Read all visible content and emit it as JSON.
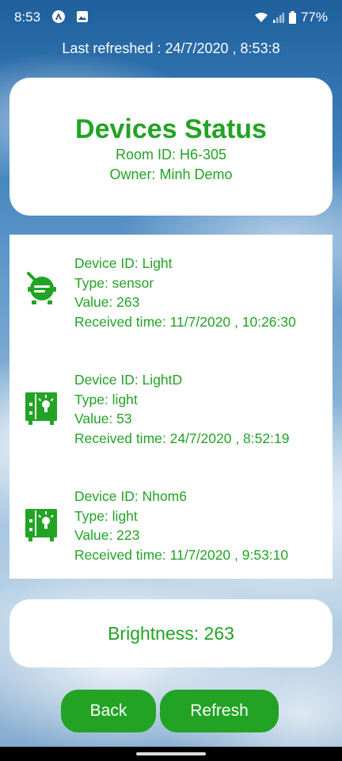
{
  "status_bar": {
    "time": "8:53",
    "battery": "77%"
  },
  "last_refreshed": "Last refreshed : 24/7/2020 , 8:53:8",
  "header": {
    "title": "Devices Status",
    "room": "Room ID: H6-305",
    "owner": "Owner: Minh Demo"
  },
  "devices": [
    {
      "icon": "sensor-icon",
      "id": "Device ID: Light",
      "type": "Type: sensor",
      "value": "Value: 263",
      "time": "Received time: 11/7/2020 , 10:26:30"
    },
    {
      "icon": "light-device-icon",
      "id": "Device ID: LightD",
      "type": "Type: light",
      "value": "Value: 53",
      "time": "Received time: 24/7/2020 , 8:52:19"
    },
    {
      "icon": "light-device-icon",
      "id": "Device ID: Nhom6",
      "type": "Type: light",
      "value": "Value: 223",
      "time": "Received time: 11/7/2020 , 9:53:10"
    }
  ],
  "brightness": "Brightness: 263",
  "buttons": {
    "back": "Back",
    "refresh": "Refresh"
  },
  "colors": {
    "accent": "#22a324",
    "card": "#ffffff"
  }
}
